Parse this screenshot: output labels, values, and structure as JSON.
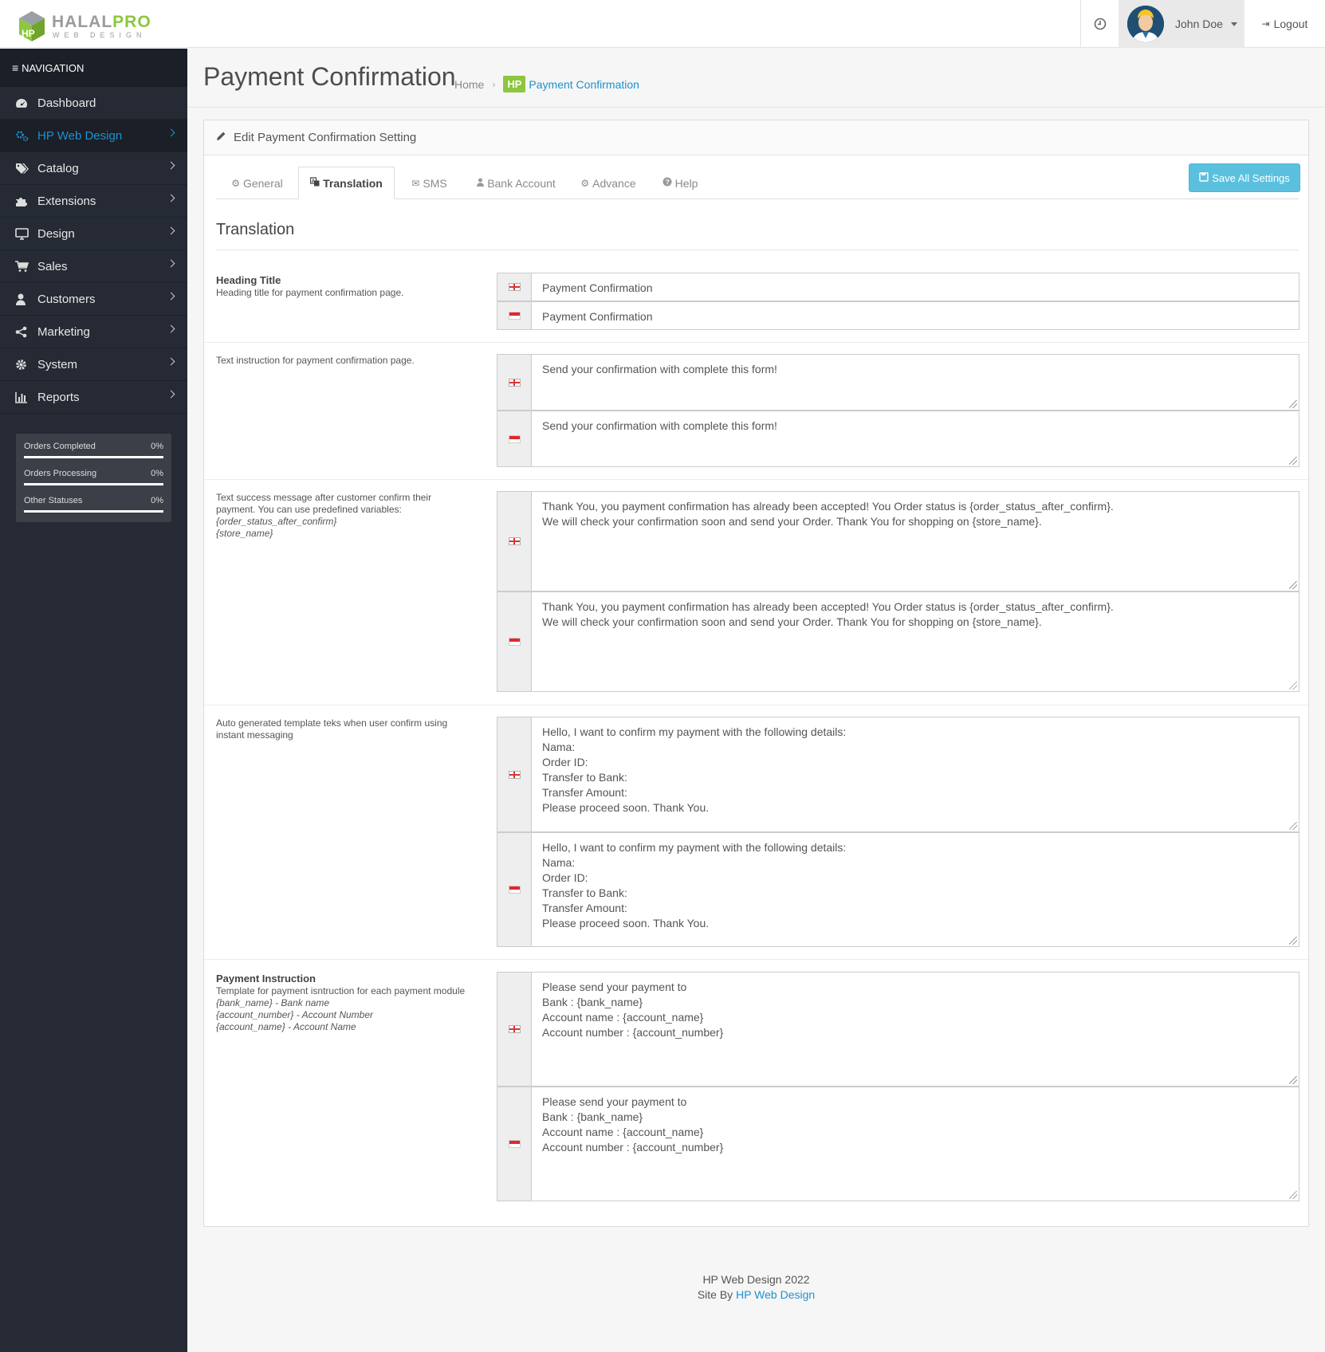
{
  "brand": {
    "name_part1": "HALAL",
    "name_part2": "PRO",
    "subtitle": "WEB DESIGN"
  },
  "header": {
    "user_name": "John Doe",
    "logout_label": "Logout"
  },
  "nav": {
    "title": "NAVIGATION",
    "items": [
      {
        "label": "Dashboard",
        "icon": "dashboard-icon"
      },
      {
        "label": "HP Web Design",
        "icon": "cogs-icon",
        "active": true
      },
      {
        "label": "Catalog",
        "icon": "tags-icon"
      },
      {
        "label": "Extensions",
        "icon": "puzzle-icon"
      },
      {
        "label": "Design",
        "icon": "monitor-icon"
      },
      {
        "label": "Sales",
        "icon": "cart-icon"
      },
      {
        "label": "Customers",
        "icon": "user-icon"
      },
      {
        "label": "Marketing",
        "icon": "share-icon"
      },
      {
        "label": "System",
        "icon": "gear-icon"
      },
      {
        "label": "Reports",
        "icon": "bar-chart-icon"
      }
    ],
    "stats": [
      {
        "label": "Orders Completed",
        "value": "0%"
      },
      {
        "label": "Orders Processing",
        "value": "0%"
      },
      {
        "label": "Other Statuses",
        "value": "0%"
      }
    ]
  },
  "page": {
    "title": "Payment Confirmation",
    "breadcrumb": {
      "home": "Home",
      "badge": "HP",
      "current": "Payment Confirmation"
    }
  },
  "panel": {
    "title": "Edit Payment Confirmation Setting",
    "save_label": "Save All Settings",
    "tabs": [
      {
        "label": "General",
        "icon": "gear-icon"
      },
      {
        "label": "Translation",
        "icon": "language-icon",
        "active": true
      },
      {
        "label": "SMS",
        "icon": "envelope-icon"
      },
      {
        "label": "Bank Account",
        "icon": "user-icon"
      },
      {
        "label": "Advance",
        "icon": "cogs-icon"
      },
      {
        "label": "Help",
        "icon": "question-icon"
      }
    ],
    "section_title": "Translation"
  },
  "fields": {
    "heading": {
      "title": "Heading Title",
      "desc": "Heading title for payment confirmation page.",
      "en": "Payment Confirmation",
      "id": "Payment Confirmation"
    },
    "instruction": {
      "desc": "Text instruction for payment confirmation page.",
      "en": "Send your confirmation with complete this form!",
      "id": "Send your confirmation with complete this form!"
    },
    "success": {
      "desc": "Text success message after customer confirm their payment. You can use predefined variables:",
      "var1": "{order_status_after_confirm}",
      "var2": "{store_name}",
      "en": "Thank You, you payment confirmation has already been accepted! You Order status is {order_status_after_confirm}.\nWe will check your confirmation soon and send your Order. Thank You for shopping on {store_name}.",
      "id": "Thank You, you payment confirmation has already been accepted! You Order status is {order_status_after_confirm}.\nWe will check your confirmation soon and send your Order. Thank You for shopping on {store_name}."
    },
    "template": {
      "desc": "Auto generated template teks when user confirm using instant messaging",
      "en": "Hello, I want to confirm my payment with the following details:\nNama:\nOrder ID:\nTransfer to Bank:\nTransfer Amount:\nPlease proceed soon. Thank You.",
      "id": "Hello, I want to confirm my payment with the following details:\nNama:\nOrder ID:\nTransfer to Bank:\nTransfer Amount:\nPlease proceed soon. Thank You."
    },
    "payment_instruction": {
      "title": "Payment Instruction",
      "desc": "Template for payment isntruction for each payment module",
      "var1": "{bank_name} - Bank name",
      "var2": "{account_number} - Account Number",
      "var3": "{account_name} - Account Name",
      "en": "Please send your payment to\nBank : {bank_name}\nAccount name : {account_name}\nAccount number : {account_number}",
      "id": "Please send your payment to\nBank : {bank_name}\nAccount name : {account_name}\nAccount number : {account_number}"
    }
  },
  "footer": {
    "line1": "HP Web Design 2022",
    "line2_prefix": "Site By ",
    "line2_link": "HP Web Design"
  },
  "colors": {
    "accent": "#1e91cf",
    "brand_green": "#8dc63f",
    "sidebar": "#252a34",
    "save_button": "#5bc0de"
  }
}
